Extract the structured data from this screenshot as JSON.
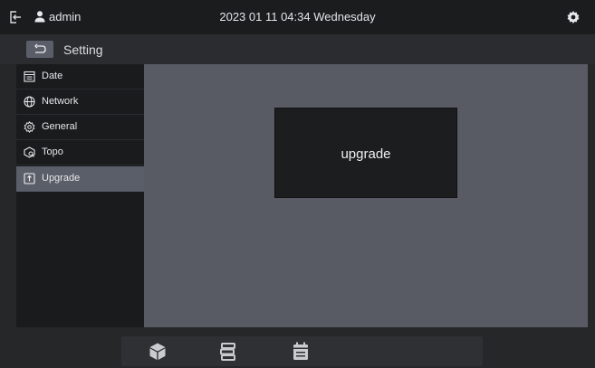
{
  "topbar": {
    "username": "admin",
    "datetime": "2023 01 11 04:34 Wednesday",
    "icons": {
      "logout": "logout-icon",
      "user": "user-icon",
      "settings": "gear-icon"
    }
  },
  "subheader": {
    "title": "Setting",
    "back_icon": "back-arrow-icon"
  },
  "sidebar": {
    "items": [
      {
        "label": "Date",
        "icon": "calendar-icon"
      },
      {
        "label": "Network",
        "icon": "globe-icon"
      },
      {
        "label": "General",
        "icon": "gear-icon"
      },
      {
        "label": "Topo",
        "icon": "topology-icon"
      },
      {
        "label": "Upgrade",
        "icon": "upgrade-icon",
        "active": true
      }
    ]
  },
  "main": {
    "dialog_text": "upgrade"
  },
  "dock": {
    "icons": [
      "cube-icon",
      "server-stack-icon",
      "schedule-icon"
    ]
  },
  "colors": {
    "topbar_bg": "#1b1c1e",
    "sidebar_bg": "#1a1b1d",
    "active_item_bg": "#5a5e68",
    "content_bg": "#585b64",
    "dialog_bg": "#1c1d1f"
  }
}
